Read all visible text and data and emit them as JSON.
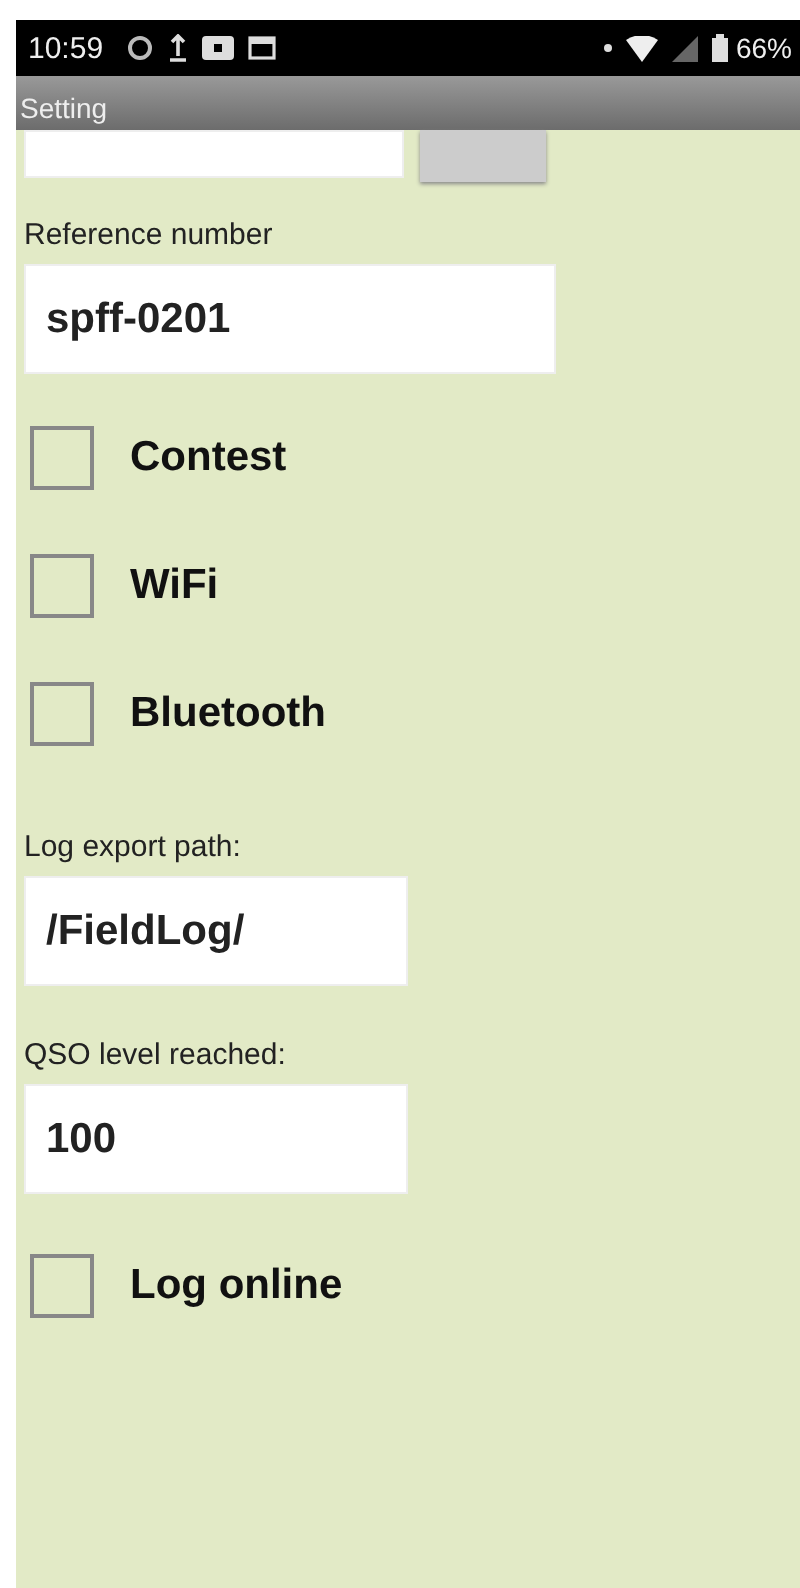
{
  "status_bar": {
    "time": "10:59",
    "battery": "66%"
  },
  "title_bar": {
    "title": "Setting"
  },
  "reference": {
    "label": "Reference number",
    "value": "spff-0201"
  },
  "options": [
    {
      "label": "Contest",
      "checked": false
    },
    {
      "label": "WiFi",
      "checked": false
    },
    {
      "label": "Bluetooth",
      "checked": false
    }
  ],
  "export_path": {
    "label": "Log export path:",
    "value": "/FieldLog/"
  },
  "qso_level": {
    "label": "QSO level reached:",
    "value": "100"
  },
  "log_online": {
    "label": "Log online",
    "checked": false
  }
}
